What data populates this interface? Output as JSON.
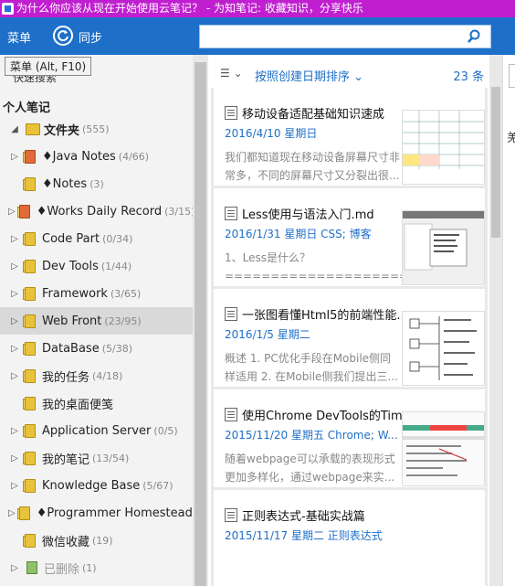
{
  "window": {
    "title": "为什么你应该从现在开始使用云笔记？ - 为知笔记: 收藏知识，分享快乐"
  },
  "toolbar": {
    "menu_label": "菜单",
    "sync_label": "同步",
    "search_value": ""
  },
  "tooltip": {
    "text": "菜单 (Alt, F10)"
  },
  "sidebar": {
    "recent_label": "快速搜索",
    "section_title": "个人笔记",
    "items": [
      {
        "label": "文件夹",
        "count": "(555)",
        "icon": "folder-icon",
        "bold": true
      },
      {
        "label": "♦Java Notes",
        "count": "(4/66)",
        "icon": "notebook-red-icon"
      },
      {
        "label": "♦Notes",
        "count": "(3)",
        "icon": "notebook-icon"
      },
      {
        "label": "♦Works Daily Record",
        "count": "(3/15)",
        "icon": "notebook-red-icon"
      },
      {
        "label": "Code Part",
        "count": "(0/34)",
        "icon": "notebook-icon"
      },
      {
        "label": "Dev Tools",
        "count": "(1/44)",
        "icon": "notebook-icon"
      },
      {
        "label": "Framework",
        "count": "(3/65)",
        "icon": "notebook-icon"
      },
      {
        "label": "Web Front",
        "count": "(23/95)",
        "icon": "notebook-icon",
        "selected": true
      },
      {
        "label": "DataBase",
        "count": "(5/38)",
        "icon": "notebook-icon"
      },
      {
        "label": "我的任务",
        "count": "(4/18)",
        "icon": "notebook-icon"
      },
      {
        "label": "我的桌面便笺",
        "count": "",
        "icon": "notebook-icon"
      },
      {
        "label": "Application Server",
        "count": "(0/5)",
        "icon": "notebook-icon"
      },
      {
        "label": "我的笔记",
        "count": "(13/54)",
        "icon": "notebook-icon"
      },
      {
        "label": "Knowledge Base",
        "count": "(5/67)",
        "icon": "notebook-icon"
      },
      {
        "label": "♦Programmer Homestead",
        "count": "(12",
        "icon": "notebook-icon"
      },
      {
        "label": "微信收藏",
        "count": "(19)",
        "icon": "notebook-icon"
      },
      {
        "label": "已删除",
        "count": "(1)",
        "icon": "trash-icon"
      }
    ]
  },
  "list": {
    "sort_label": "按照创建日期排序",
    "count_label": "23 条",
    "notes": [
      {
        "title": "移动设备适配基础知识速成",
        "meta": "2016/4/10 星期日",
        "summary": "我们都知道现在移动设备屏幕尺寸非常多，不同的屏幕尺寸又分裂出很..."
      },
      {
        "title": "Less使用与语法入门.md",
        "meta": "2016/1/31 星期日   CSS; 博客",
        "summary": "1、Less是什么？ ===================== Less类似于j..."
      },
      {
        "title": "一张图看懂Html5的前端性能...",
        "meta": "2016/1/5 星期二",
        "summary": " 概述 1. PC优化手段在Mobile侧同样适用 2. 在Mobile侧我们提出三..."
      },
      {
        "title": "使用Chrome DevTools的Tim...",
        "meta": "2015/11/20 星期五   Chrome; W...",
        "summary": " 随着webpage可以承载的表现形式更加多样化，通过webpage来实..."
      },
      {
        "title": "正则表达式-基础实战篇",
        "meta": "2015/11/17 星期二   正则表达式",
        "summary": ""
      }
    ]
  },
  "right_panel": {
    "partial_char": "羌"
  },
  "colors": {
    "titlebar": "#c01fd0",
    "toolbar": "#1e6fc8",
    "accent": "#1e6fc8"
  }
}
